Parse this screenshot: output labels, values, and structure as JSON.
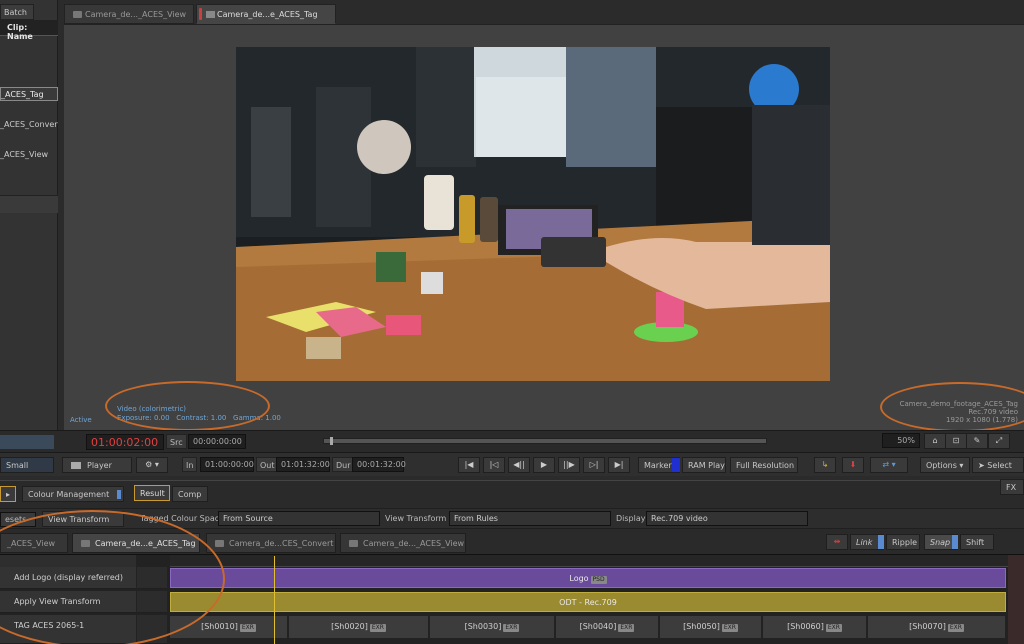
{
  "left_panel": {
    "batch_tab": "Batch",
    "column_header": "Clip: Name",
    "clips": [
      "_ACES_Tag",
      "_ACES_Convert",
      "_ACES_View"
    ]
  },
  "viewer": {
    "tabs": [
      "Camera_de..._ACES_View",
      "Camera_de...e_ACES_Tag"
    ],
    "status": "Active",
    "video_mode": "Video (colorimetric)",
    "exposure": "Exposure: 0.00",
    "contrast": "Contrast: 1.00",
    "gamma": "Gamma: 1.00",
    "clip_name": "Camera_demo_footage_ACES_Tag",
    "display": "Rec.709 video",
    "resolution": "1920 x 1080 (1.778)"
  },
  "transport": {
    "timecode": "01:00:02:00",
    "src_label": "Src",
    "src_value": "00:00:00:00",
    "size_label": "Small",
    "player_label": "Player",
    "in_label": "In",
    "in_value": "01:00:00:00",
    "out_label": "Out",
    "out_value": "01:01:32:00",
    "dur_label": "Dur",
    "dur_value": "00:01:32:00",
    "marker_label": "Marker",
    "ram_play_label": "RAM Play",
    "resolution_label": "Full Resolution",
    "zoom": "50%",
    "options_label": "Options",
    "select_label": "Select"
  },
  "panel": {
    "tab_cm": "Colour Management",
    "tab_result": "Result",
    "tab_comp": "Comp",
    "fx_label": "FX",
    "presets_label": "esets",
    "view_transform_btn": "View Transform",
    "tagged_cs_label": "Tagged Colour Space",
    "tagged_cs_value": "From Source",
    "view_transform_label": "View Transform",
    "view_transform_value": "From Rules",
    "display_label": "Display",
    "display_value": "Rec.709 video"
  },
  "sequence_tabs": [
    "_ACES_View",
    "Camera_de...e_ACES_Tag",
    "Camera_de...CES_Convert",
    "Camera_de..._ACES_View"
  ],
  "timeline_tools": {
    "link": "Link",
    "ripple": "Ripple",
    "snap": "Snap",
    "shift": "Shift"
  },
  "tracks": {
    "labels": [
      "Add Logo (display referred)",
      "Apply View Transform",
      "TAG ACES 2065-1"
    ],
    "logo_segment": "Logo",
    "logo_badge": "PSD",
    "odt_segment": "ODT - Rec.709",
    "shots": [
      {
        "name": "[Sh0010]",
        "badge": "EXR"
      },
      {
        "name": "[Sh0020]",
        "badge": "EXR"
      },
      {
        "name": "[Sh0030]",
        "badge": "EXR"
      },
      {
        "name": "[Sh0040]",
        "badge": "EXR"
      },
      {
        "name": "[Sh0050]",
        "badge": "EXR"
      },
      {
        "name": "[Sh0060]",
        "badge": "EXR"
      },
      {
        "name": "[Sh0070]",
        "badge": "EXR"
      }
    ]
  },
  "colors": {
    "accent_orange": "#c86a2a",
    "timecode_red": "#e04040",
    "logo_purple": "#6a4a9a",
    "odt_gold": "#9a8a30",
    "info_blue": "#6fa6d8"
  }
}
